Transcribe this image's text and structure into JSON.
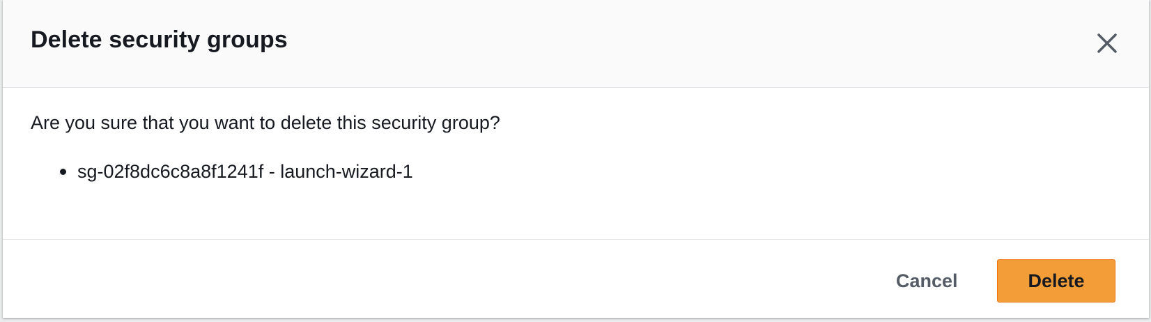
{
  "dialog": {
    "title": "Delete security groups",
    "message": "Are you sure that you want to delete this security group?",
    "items": [
      {
        "label": "sg-02f8dc6c8a8f1241f - launch-wizard-1"
      }
    ],
    "cancel_label": "Cancel",
    "delete_label": "Delete"
  },
  "colors": {
    "primary_button": "#f29d38",
    "header_background": "#fafafa",
    "text": "#16191f",
    "secondary_text": "#545b64"
  },
  "icons": {
    "close": "close-icon"
  }
}
